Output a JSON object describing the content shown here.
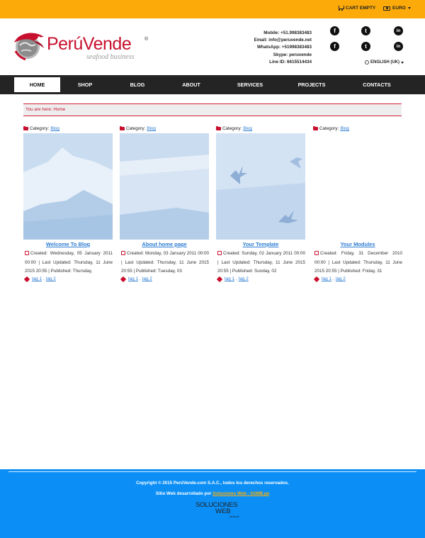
{
  "topbar": {
    "cart_label": "CART EMPTY",
    "currency_label": "EURO"
  },
  "brand": {
    "name": "PerúVende",
    "reg_mark": "®",
    "tagline": "seafood business",
    "color": "#c8102e"
  },
  "contact": {
    "lines": [
      "Mobile: +51.998383483",
      "Email: info@peruvende.net",
      "WhatsApp: +51998383483",
      "Skype: peruvende",
      "Line ID: 6615514434"
    ]
  },
  "social": {
    "icons": [
      {
        "name": "facebook-icon",
        "glyph": "f"
      },
      {
        "name": "tumblr-icon",
        "glyph": "t"
      },
      {
        "name": "linkedin-icon",
        "glyph": "in"
      },
      {
        "name": "facebook-icon",
        "glyph": "f"
      },
      {
        "name": "tumblr-icon",
        "glyph": "t"
      },
      {
        "name": "linkedin-icon",
        "glyph": "in"
      }
    ]
  },
  "language": {
    "selected": "ENGLISH (UK)"
  },
  "nav": {
    "items": [
      "HOME",
      "SHOP",
      "BLOG",
      "ABOUT",
      "SERVICES",
      "PROJECTS",
      "CONTACTS"
    ],
    "active": "HOME"
  },
  "breadcrumb": {
    "text": "You are here:  Home"
  },
  "articles": [
    {
      "category_prefix": "Category:",
      "category": "Blog",
      "title": "Welcome To Blog",
      "meta": "Created: Wednesday, 05 January 2011 00:00 | Last Updated: Thursday, 11 June 2015 20:55 | Published: Thursday,",
      "tags": [
        "tag 1",
        "tag 2"
      ]
    },
    {
      "category_prefix": "Category:",
      "category": "Blog",
      "title": "About home page",
      "meta": "Created: Monday, 03 January 2011 00:00 | Last Updated: Thursday, 11 June 2015 20:55 | Published: Tuesday, 03",
      "tags": [
        "tag 1",
        "tag 2"
      ]
    },
    {
      "category_prefix": "Category:",
      "category": "Blog",
      "title": "Your Template",
      "meta": "Created: Sunday, 02 January 2011 00:00 | Last Updated: Thursday, 11 June 2015 20:55 | Published: Sunday, 02",
      "tags": [
        "tag 1",
        "tag 2"
      ]
    },
    {
      "category_prefix": "Category:",
      "category": "Blog",
      "title": "Your Modules",
      "meta": "Created: Friday, 31 December 2010 00:00 | Last Updated: Thursday, 11 June 2015 20:55 | Published: Friday, 31",
      "tags": [
        "tag 1",
        "tag 2"
      ]
    }
  ],
  "footer": {
    "copyright": "Copyright © 2015 PerúVende.com S.A.C., todos los derechos reservados.",
    "dev_prefix": "Sitio Web desarrollado por",
    "dev_link": "Soluciones Web - SSMB.pe",
    "logo_line1": "SOLUCIONES",
    "logo_line2": "WEB",
    "logo_line3": "ssmb.pe",
    "bg_color": "#0b8ff7",
    "accent_color": "#ffb000"
  }
}
